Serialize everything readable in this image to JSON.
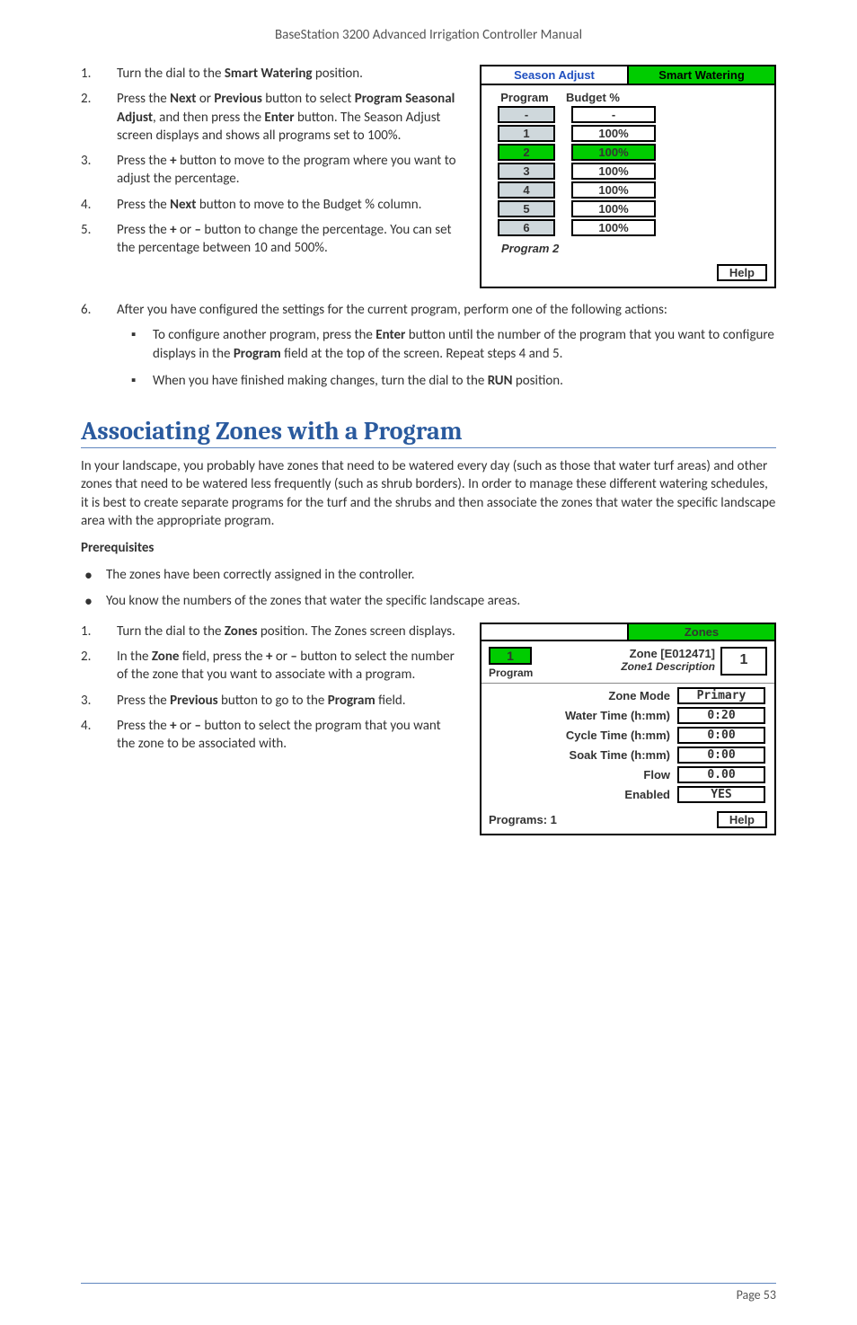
{
  "header": {
    "title": "BaseStation 3200 Advanced Irrigation Controller Manual"
  },
  "steps_a": {
    "s1": {
      "num": "1.",
      "txt_a": "Turn the dial to the ",
      "bold": "Smart Watering",
      "txt_b": " position."
    },
    "s2": {
      "num": "2.",
      "txt_a": "Press the ",
      "b1": "Next",
      "txt_b": " or ",
      "b2": "Previous",
      "txt_c": " button to select ",
      "b3": "Program Seasonal Adjust",
      "txt_d": ", and then press the ",
      "b4": "Enter",
      "txt_e": " button. The Season Adjust screen displays and shows all programs set to 100%."
    },
    "s3": {
      "num": "3.",
      "txt_a": "Press the ",
      "b1": "+",
      "txt_b": " button to move to the program where you want to adjust the percentage."
    },
    "s4": {
      "num": "4.",
      "txt_a": "Press the ",
      "b1": "Next",
      "txt_b": " button to move to the Budget % column."
    },
    "s5": {
      "num": "5.",
      "txt_a": "Press the ",
      "b1": "+",
      "txt_b": " or ",
      "b2": "–",
      "txt_c": " button to change the percentage. You can set the percentage between 10 and 500%."
    },
    "s6": {
      "num": "6.",
      "txt": "After you have configured the settings for the current program, perform one of the following actions:"
    },
    "sub1": {
      "txt_a": "To configure another program, press the ",
      "b1": "Enter",
      "txt_b": " button until the number of the program that you want to configure displays in the ",
      "b2": "Program",
      "txt_c": " field at the top of the screen. Repeat steps 4 and 5."
    },
    "sub2": {
      "txt_a": "When you have finished making changes, turn the dial to the ",
      "b1": "RUN",
      "txt_b": " position."
    }
  },
  "season_screen": {
    "tab_left": "Season Adjust",
    "tab_right": "Smart Watering",
    "col1": "Program",
    "col2": "Budget %",
    "rows": [
      {
        "prog": "-",
        "pct": "-",
        "active": false
      },
      {
        "prog": "1",
        "pct": "100%",
        "active": false
      },
      {
        "prog": "2",
        "pct": "100%",
        "active": true
      },
      {
        "prog": "3",
        "pct": "100%",
        "active": false
      },
      {
        "prog": "4",
        "pct": "100%",
        "active": false
      },
      {
        "prog": "5",
        "pct": "100%",
        "active": false
      },
      {
        "prog": "6",
        "pct": "100%",
        "active": false
      }
    ],
    "footnote": "Program 2",
    "help": "Help"
  },
  "section": {
    "title": "Associating Zones with a Program"
  },
  "intro": "In your landscape, you probably have zones that need to be watered every day (such as those that water turf areas) and other zones that need to be watered less frequently (such as shrub borders). In order to manage these different watering schedules, it is best to create separate programs for the turf and the shrubs and then associate the zones that water the specific landscape area with the appropriate program.",
  "prereq_title": "Prerequisites",
  "prereqs": {
    "p1": "The zones have been correctly assigned in the controller.",
    "p2": "You know the numbers of the zones that water the specific landscape areas."
  },
  "steps_b": {
    "s1": {
      "num": "1.",
      "txt_a": "Turn the dial to the ",
      "b1": "Zones",
      "txt_b": " position. The Zones screen displays."
    },
    "s2": {
      "num": "2.",
      "txt_a": "In the ",
      "b1": "Zone",
      "txt_b": " field, press the ",
      "b2": "+",
      "txt_c": " or ",
      "b3": "–",
      "txt_d": " button to select the number of the zone that you want to associate with a program."
    },
    "s3": {
      "num": "3.",
      "txt_a": "Press the ",
      "b1": "Previous",
      "txt_b": " button to go to the ",
      "b2": "Program",
      "txt_c": " field."
    },
    "s4": {
      "num": "4.",
      "txt_a": "Press the ",
      "b1": "+",
      "txt_b": " or ",
      "b2": "–",
      "txt_c": " button to select the program that you want the zone to be associated with."
    }
  },
  "zones_screen": {
    "tab": "Zones",
    "program_label": "Program",
    "program_value": "1",
    "zone_label": "Zone [E012471]",
    "zone_sub": "Zone1 Description",
    "zone_value": "1",
    "rows": [
      {
        "label": "Zone Mode",
        "value": "Primary"
      },
      {
        "label": "Water Time (h:mm)",
        "value": "0:20"
      },
      {
        "label": "Cycle Time (h:mm)",
        "value": "0:00"
      },
      {
        "label": "Soak Time (h:mm)",
        "value": "0:00"
      },
      {
        "label": "Flow",
        "value": "0.00"
      },
      {
        "label": "Enabled",
        "value": "YES"
      }
    ],
    "foot": "Programs: 1",
    "help": "Help"
  },
  "footer": {
    "page": "Page 53"
  }
}
